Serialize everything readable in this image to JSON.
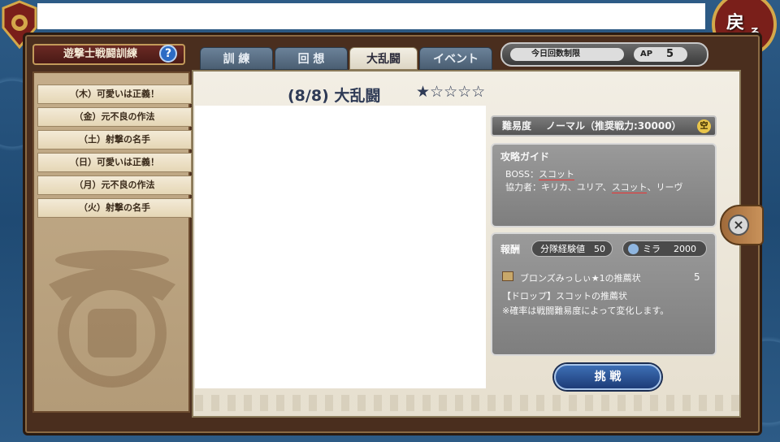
{
  "header": {
    "title": "遊撃士戦闘訓練",
    "back_label": "戻",
    "back_sub": "る"
  },
  "tabs": [
    {
      "label": "訓 練",
      "active": false
    },
    {
      "label": "回 想",
      "active": false
    },
    {
      "label": "大乱闘",
      "active": true
    },
    {
      "label": "イベント",
      "active": false
    }
  ],
  "limit": {
    "label": "今日回数制限",
    "ap_label": "AP",
    "ap_value": "5"
  },
  "sidebar": {
    "items": [
      {
        "label": "（木）可愛いは正義！"
      },
      {
        "label": "（金）元不良の作法"
      },
      {
        "label": "（土）射撃の名手"
      },
      {
        "label": "（日）可愛いは正義！"
      },
      {
        "label": "（月）元不良の作法"
      },
      {
        "label": "（火）射撃の名手"
      }
    ]
  },
  "stage": {
    "title": "(8/8) 大乱闘",
    "stars": "★☆☆☆☆"
  },
  "difficulty": {
    "label": "難易度",
    "value": "ノーマル（推奨戦力:30000）",
    "badge": "空"
  },
  "guide": {
    "title": "攻略ガイド",
    "boss_prefix": "BOSS：",
    "boss_name": "スコット",
    "helpers_prefix": "協力者：キリカ、ユリア、",
    "helpers_highlight": "スコット",
    "helpers_suffix": "、リーヴ"
  },
  "reward": {
    "label": "報酬",
    "exp_label": "分隊経験値",
    "exp_value": "50",
    "mira_label": "ミラ",
    "mira_value": "2000",
    "item_name": "ブロンズみっしぃ★1の推薦状",
    "item_qty": "5",
    "drop_line": "【ドロップ】スコットの推薦状",
    "note_line": "※確率は戦闘難易度によって変化します。"
  },
  "actions": {
    "challenge_label": "挑 戦",
    "help_label": "?",
    "close_label": "×"
  },
  "colors": {
    "accent": "#2c6bc4",
    "frame": "#4a2e1e",
    "title_text": "#2e3a55"
  }
}
